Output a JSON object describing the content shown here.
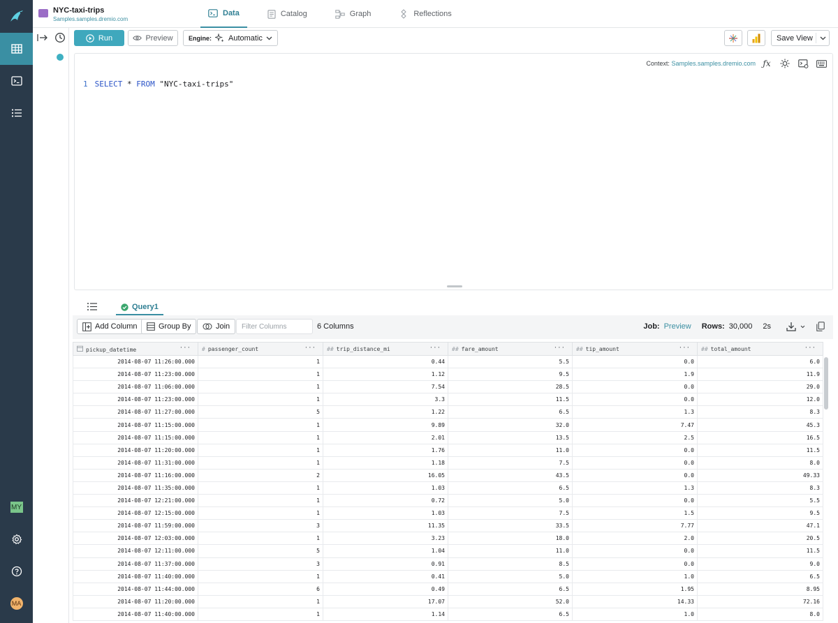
{
  "dataset": {
    "title": "NYC-taxi-trips",
    "path": "Samples.samples.dremio.com"
  },
  "tabs": [
    {
      "label": "Data",
      "icon": "terminal-icon"
    },
    {
      "label": "Catalog",
      "icon": "document-icon"
    },
    {
      "label": "Graph",
      "icon": "graph-icon"
    },
    {
      "label": "Reflections",
      "icon": "reflections-icon"
    }
  ],
  "toolbar": {
    "run_label": "Run",
    "preview_label": "Preview",
    "engine_label": "Engine:",
    "engine_value": "Automatic",
    "save_view_label": "Save View"
  },
  "editor": {
    "context_label": "Context:",
    "context_value": "Samples.samples.dremio.com",
    "line_number": "1",
    "kw_select": "SELECT",
    "star": "*",
    "kw_from": "FROM",
    "table_ref": "\"NYC-taxi-trips\""
  },
  "results": {
    "query_tab": "Query1",
    "add_column": "Add Column",
    "group_by": "Group By",
    "join": "Join",
    "filter_placeholder": "Filter Columns",
    "columns_count": "6 Columns",
    "job_label": "Job:",
    "job_value": "Preview",
    "rows_label": "Rows:",
    "rows_value": "30,000",
    "duration": "2s"
  },
  "table": {
    "columns": [
      {
        "name": "pickup_datetime",
        "type_icon": "calendar-icon"
      },
      {
        "name": "passenger_count",
        "type_icon": "#"
      },
      {
        "name": "trip_distance_mi",
        "type_icon": "##"
      },
      {
        "name": "fare_amount",
        "type_icon": "##"
      },
      {
        "name": "tip_amount",
        "type_icon": "##"
      },
      {
        "name": "total_amount",
        "type_icon": "##"
      }
    ],
    "rows": [
      [
        "2014-08-07 11:26:00.000",
        "1",
        "0.44",
        "5.5",
        "0.0",
        "6.0"
      ],
      [
        "2014-08-07 11:23:00.000",
        "1",
        "1.12",
        "9.5",
        "1.9",
        "11.9"
      ],
      [
        "2014-08-07 11:06:00.000",
        "1",
        "7.54",
        "28.5",
        "0.0",
        "29.0"
      ],
      [
        "2014-08-07 11:23:00.000",
        "1",
        "3.3",
        "11.5",
        "0.0",
        "12.0"
      ],
      [
        "2014-08-07 11:27:00.000",
        "5",
        "1.22",
        "6.5",
        "1.3",
        "8.3"
      ],
      [
        "2014-08-07 11:15:00.000",
        "1",
        "9.89",
        "32.0",
        "7.47",
        "45.3"
      ],
      [
        "2014-08-07 11:15:00.000",
        "1",
        "2.01",
        "13.5",
        "2.5",
        "16.5"
      ],
      [
        "2014-08-07 11:20:00.000",
        "1",
        "1.76",
        "11.0",
        "0.0",
        "11.5"
      ],
      [
        "2014-08-07 11:31:00.000",
        "1",
        "1.18",
        "7.5",
        "0.0",
        "8.0"
      ],
      [
        "2014-08-07 11:16:00.000",
        "2",
        "16.05",
        "43.5",
        "0.0",
        "49.33"
      ],
      [
        "2014-08-07 11:35:00.000",
        "1",
        "1.03",
        "6.5",
        "1.3",
        "8.3"
      ],
      [
        "2014-08-07 12:21:00.000",
        "1",
        "0.72",
        "5.0",
        "0.0",
        "5.5"
      ],
      [
        "2014-08-07 12:15:00.000",
        "1",
        "1.03",
        "7.5",
        "1.5",
        "9.5"
      ],
      [
        "2014-08-07 11:59:00.000",
        "3",
        "11.35",
        "33.5",
        "7.77",
        "47.1"
      ],
      [
        "2014-08-07 12:03:00.000",
        "1",
        "3.23",
        "18.0",
        "2.0",
        "20.5"
      ],
      [
        "2014-08-07 12:11:00.000",
        "5",
        "1.04",
        "11.0",
        "0.0",
        "11.5"
      ],
      [
        "2014-08-07 11:37:00.000",
        "3",
        "0.91",
        "8.5",
        "0.0",
        "9.0"
      ],
      [
        "2014-08-07 11:40:00.000",
        "1",
        "0.41",
        "5.0",
        "1.0",
        "6.5"
      ],
      [
        "2014-08-07 11:44:00.000",
        "6",
        "0.49",
        "6.5",
        "1.95",
        "8.95"
      ],
      [
        "2014-08-07 11:20:00.000",
        "1",
        "17.07",
        "52.0",
        "14.33",
        "72.16"
      ],
      [
        "2014-08-07 11:40:00.000",
        "1",
        "1.14",
        "6.5",
        "1.0",
        "8.0"
      ]
    ]
  },
  "sidebar": {
    "user_badge": "MY",
    "avatar": "MA"
  },
  "colors": {
    "accent": "#3a8fa3",
    "sidebar": "#2a3a4a",
    "run_button": "#3fa8bd"
  }
}
